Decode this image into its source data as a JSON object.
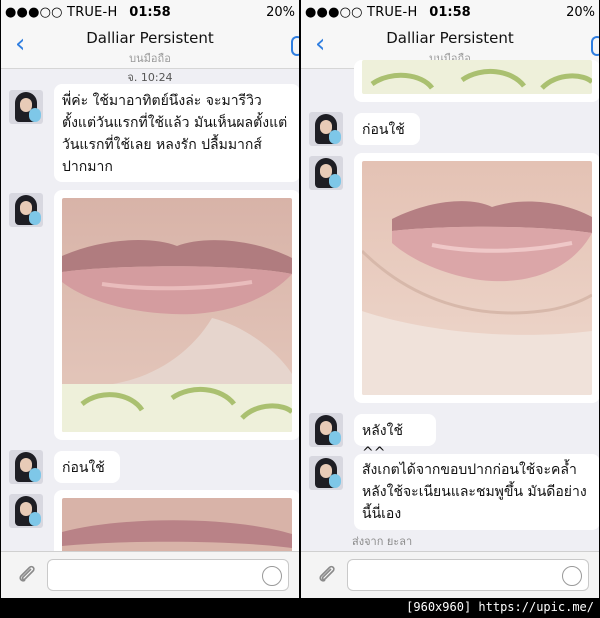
{
  "status": {
    "carrier": "●●●○○ TRUE-H",
    "time": "01:58",
    "battery": "20%"
  },
  "nav": {
    "back_icon": "chevron-left-icon",
    "title": "Dalliar Persistent",
    "subtitle": "บนมือถือ"
  },
  "left": {
    "timestamp": "จ. 10:24",
    "message1": "พี่ค่ะ ใช้มาอาทิตย์นึงล่ะ จะมารีวิวตั้งแต่วันแรกที่ใช้แล้ว มันเห็นผลตั้งแต่วันแรกที่ใช้เลย หลงรัก ปลื้มมากส์ปากมาก",
    "message2": "ก่อนใช้"
  },
  "right": {
    "message1": "ก่อนใช้",
    "message2": "หลังใช้ ^^",
    "message3": "สังเกตได้จากขอบปากก่อนใช้จะคล้ำ หลังใช้จะเนียนและชมพูขึ้น มันดีอย่างนี้นี่เอง",
    "sent_from": "ส่งจาก ยะลา"
  },
  "input": {
    "attach_icon": "paperclip-icon",
    "emoji_icon": "smiley-icon"
  },
  "watermark": "[960x960] https://upic.me/",
  "colors": {
    "accent": "#2f7ee0",
    "background": "#efeff4",
    "bubble": "#ffffff"
  }
}
